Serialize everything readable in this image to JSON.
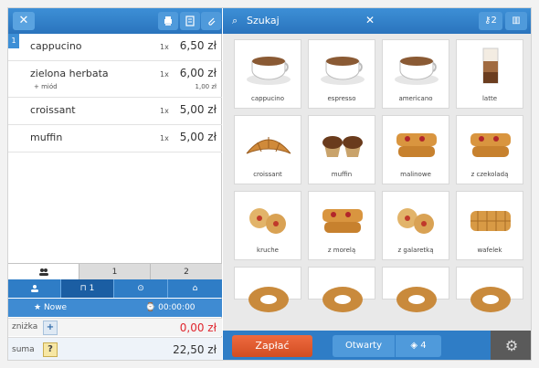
{
  "colors": {
    "accent": "#2f7dc6",
    "pay": "#e05a2e",
    "discount": "#e0262e"
  },
  "left_toolbar": {
    "close_glyph": "✕"
  },
  "orders": [
    {
      "name": "cappucino",
      "qty": "1x",
      "price": "6,50 zł"
    },
    {
      "name": "zielona herbata",
      "sub": "+ miód",
      "qty": "1x",
      "price": "6,00 zł",
      "sub_price": "1,00 zł"
    },
    {
      "name": "croissant",
      "qty": "1x",
      "price": "5,00 zł"
    },
    {
      "name": "muffin",
      "qty": "1x",
      "price": "5,00 zł"
    }
  ],
  "order_index": "1",
  "tabs": [
    "1",
    "2"
  ],
  "actions": {
    "table_label": "1",
    "new_label": "Nowe",
    "time": "00:00:00"
  },
  "summary": {
    "discount_label": "zniżka",
    "discount_btn": "+",
    "discount_value": "0,00 zł",
    "total_label": "suma",
    "total_btn": "?",
    "total_value": "22,50 zł"
  },
  "search": {
    "placeholder": "Szukaj",
    "clear_glyph": "✕"
  },
  "right_toolbar": {
    "keys_count": "2"
  },
  "products": [
    {
      "label": "cappucino",
      "icon": "cup-icon"
    },
    {
      "label": "espresso",
      "icon": "cup-icon"
    },
    {
      "label": "americano",
      "icon": "cup-icon"
    },
    {
      "label": "latte",
      "icon": "glass-icon"
    },
    {
      "label": "croissant",
      "icon": "croissant-icon"
    },
    {
      "label": "muffin",
      "icon": "muffin-icon"
    },
    {
      "label": "malinowe",
      "icon": "pastry-icon"
    },
    {
      "label": "z czekoladą",
      "icon": "pastry-icon"
    },
    {
      "label": "kruche",
      "icon": "cookie-icon"
    },
    {
      "label": "z morelą",
      "icon": "pastry-icon"
    },
    {
      "label": "z galaretką",
      "icon": "cookie-icon"
    },
    {
      "label": "wafelek",
      "icon": "waffle-icon"
    },
    {
      "label": "",
      "icon": "bagel-icon"
    },
    {
      "label": "",
      "icon": "bagel-icon"
    },
    {
      "label": "",
      "icon": "bagel-icon"
    },
    {
      "label": "",
      "icon": "bagel-icon"
    }
  ],
  "bottom": {
    "pay_label": "Zapłać",
    "open_label": "Otwarty",
    "open_count": "4"
  }
}
